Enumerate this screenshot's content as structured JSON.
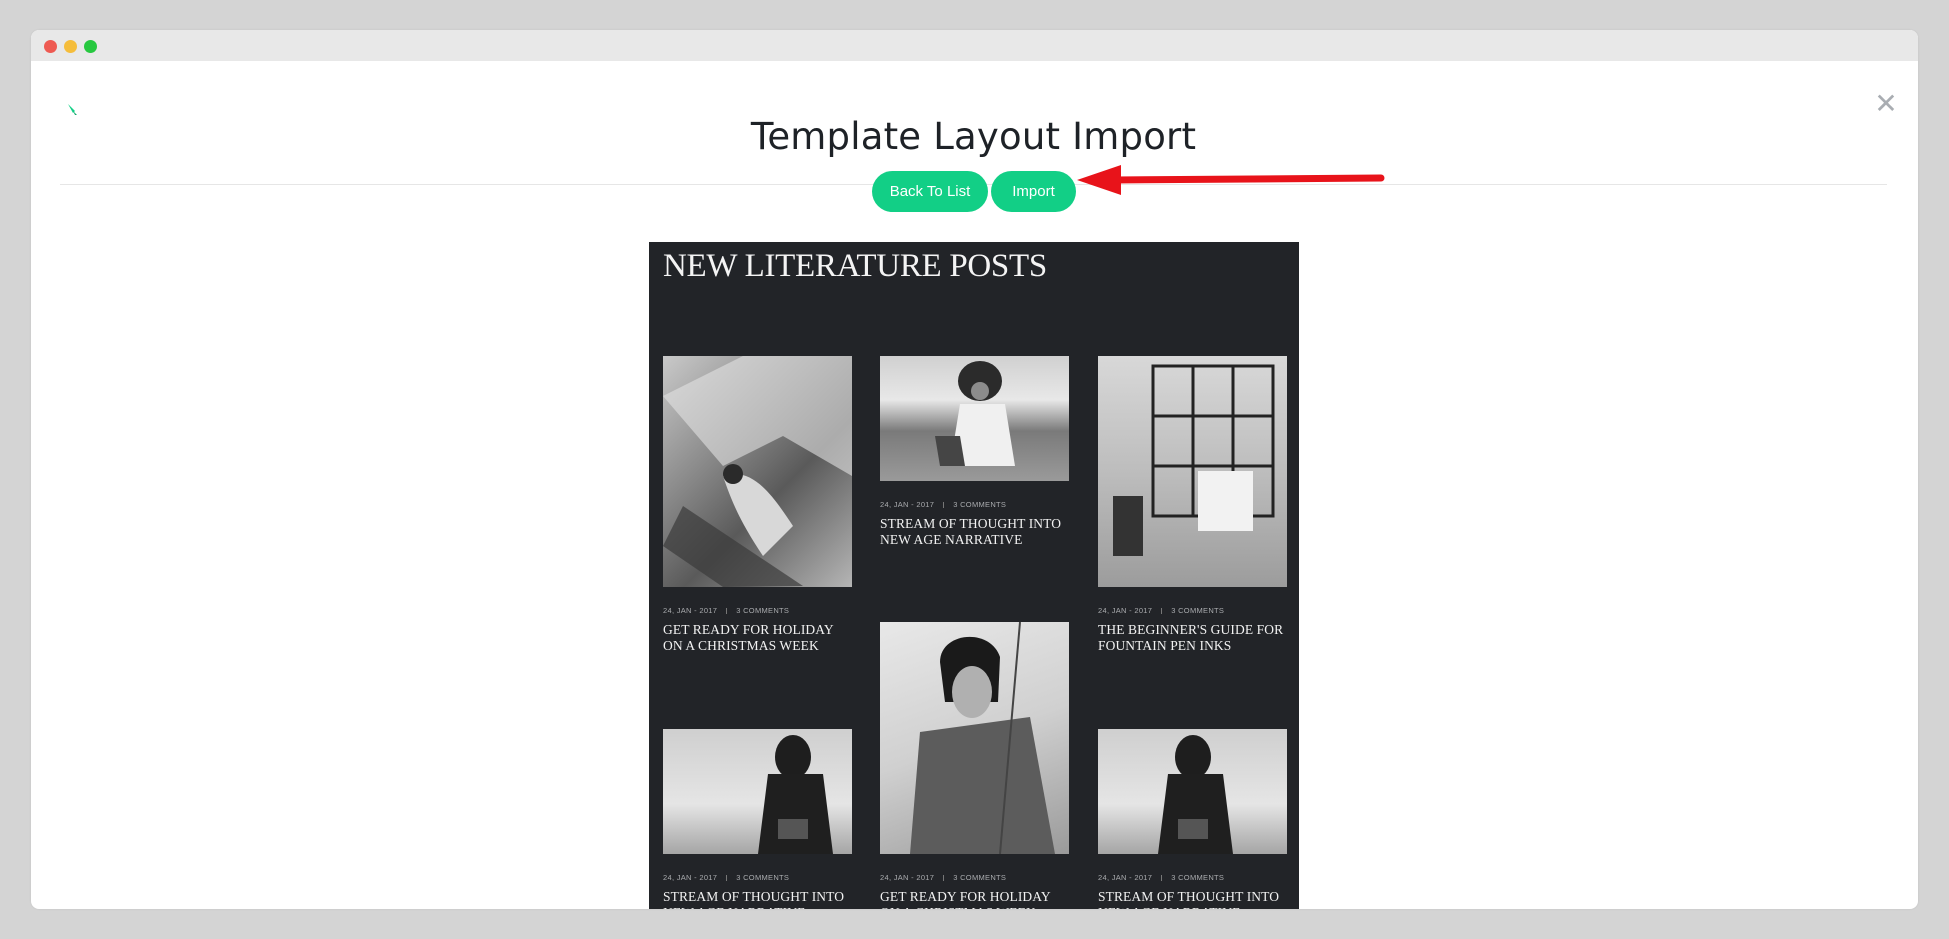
{
  "window": {
    "controls": [
      "close",
      "minimize",
      "maximize"
    ]
  },
  "header": {
    "title": "Template Layout Import",
    "logo_icon": "brand-logo-icon",
    "close_symbol": "✕"
  },
  "actions": {
    "back_label": "Back To List",
    "import_label": "Import"
  },
  "colors": {
    "accent": "#12cf86",
    "arrow": "#e8131a",
    "preview_bg": "#222428"
  },
  "preview": {
    "heading": "NEW LITERATURE POSTS",
    "posts": [
      {
        "date": "24, JAN - 2017",
        "comments": "3 COMMENTS",
        "title": "GET READY FOR HOLIDAY ON A CHRISTMAS WEEK"
      },
      {
        "date": "24, JAN - 2017",
        "comments": "3 COMMENTS",
        "title": "STREAM OF THOUGHT INTO NEW AGE NARRATIVE"
      },
      {
        "date": "24, JAN - 2017",
        "comments": "3 COMMENTS",
        "title": "THE BEGINNER'S GUIDE FOR FOUNTAIN PEN INKS"
      },
      {
        "date": "24, JAN - 2017",
        "comments": "3 COMMENTS",
        "title": "STREAM OF THOUGHT INTO NEW AGE NARRATIVE"
      },
      {
        "date": "24, JAN - 2017",
        "comments": "3 COMMENTS",
        "title": "GET READY FOR HOLIDAY ON A CHRISTMAS WEEK"
      },
      {
        "date": "24, JAN - 2017",
        "comments": "3 COMMENTS",
        "title": "STREAM OF THOUGHT INTO NEW AGE NARRATIVE"
      }
    ]
  }
}
